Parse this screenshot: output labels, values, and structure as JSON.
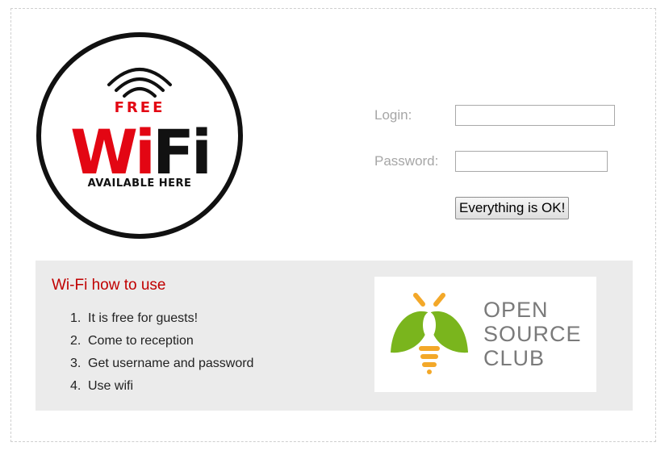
{
  "logo": {
    "top_text": "FREE",
    "main_text_red": "Wi",
    "main_text_black": "Fi",
    "bottom_text": "AVAILABLE HERE",
    "colors": {
      "red": "#e30613",
      "black": "#111111",
      "ring": "#111111"
    }
  },
  "login_form": {
    "login_label": "Login:",
    "login_value": "",
    "password_label": "Password:",
    "password_value": "",
    "submit_label": "Everything is OK!"
  },
  "info": {
    "title": "Wi-Fi how to use",
    "title_color": "#c00000",
    "steps": [
      {
        "num": "1.",
        "text": "It is free for guests!"
      },
      {
        "num": "2.",
        "text": "Come to reception"
      },
      {
        "num": "3.",
        "text": "Get username and password"
      },
      {
        "num": "4.",
        "text": "Use wifi"
      }
    ]
  },
  "club_logo": {
    "lines": [
      "OPEN",
      "SOURCE",
      "CLUB"
    ],
    "icon": "firefly-bulb-icon",
    "colors": {
      "green": "#7ab51d",
      "orange": "#f3a829",
      "text": "#7a7a7a"
    }
  }
}
